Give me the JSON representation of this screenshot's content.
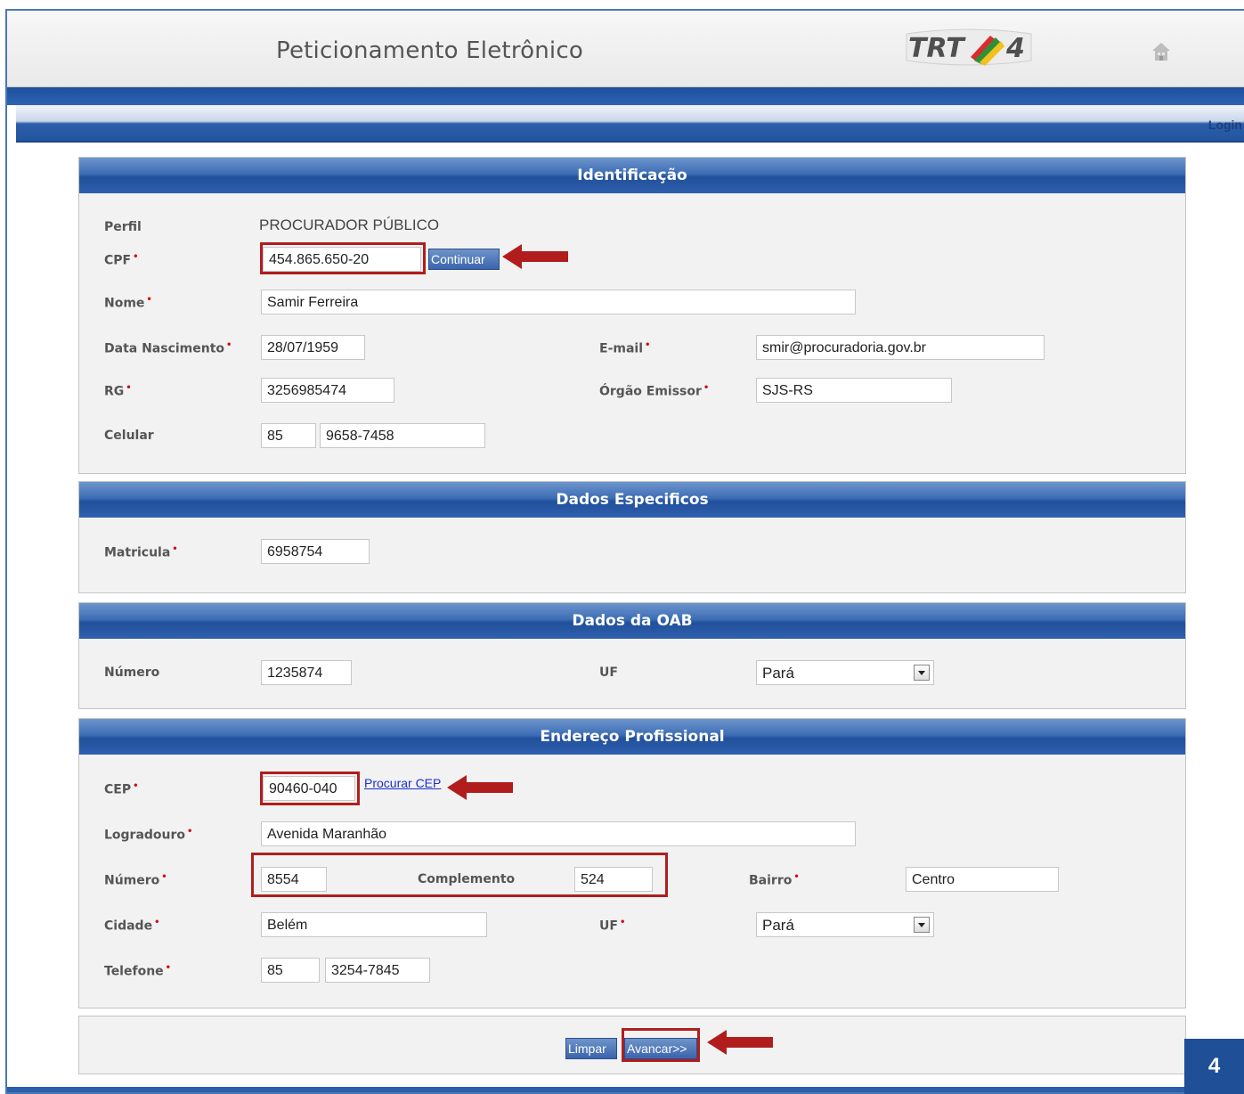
{
  "header": {
    "title": "Peticionamento Eletrônico",
    "logo_text": "TRT",
    "logo_number": "4"
  },
  "nav": {
    "login": "Login"
  },
  "identificacao": {
    "title": "Identificação",
    "perfil_label": "Perfil",
    "perfil_value": "PROCURADOR PÚBLICO",
    "cpf_label": "CPF",
    "cpf_value": "454.865.650-20",
    "continuar_button": "Continuar",
    "nome_label": "Nome",
    "nome_value": "Samir Ferreira",
    "data_nascimento_label": "Data Nascimento",
    "data_nascimento_value": "28/07/1959",
    "email_label": "E-mail",
    "email_value": "smir@procuradoria.gov.br",
    "rg_label": "RG",
    "rg_value": "3256985474",
    "orgao_emissor_label": "Órgão Emissor",
    "orgao_emissor_value": "SJS-RS",
    "celular_label": "Celular",
    "celular_ddd": "85",
    "celular_numero": "9658-7458"
  },
  "dados_especificos": {
    "title": "Dados Especificos",
    "matricula_label": "Matricula",
    "matricula_value": "6958754"
  },
  "dados_oab": {
    "title": "Dados da OAB",
    "numero_label": "Número",
    "numero_value": "1235874",
    "uf_label": "UF",
    "uf_value": "Pará"
  },
  "endereco": {
    "title": "Endereço Profissional",
    "cep_label": "CEP",
    "cep_value": "90460-040",
    "procurar_cep_link": "Procurar CEP",
    "logradouro_label": "Logradouro",
    "logradouro_value": "Avenida Maranhão",
    "numero_label": "Número",
    "numero_value": "8554",
    "complemento_label": "Complemento",
    "complemento_value": "524",
    "bairro_label": "Bairro",
    "bairro_value": "Centro",
    "cidade_label": "Cidade",
    "cidade_value": "Belém",
    "uf_label": "UF",
    "uf_value": "Pará",
    "telefone_label": "Telefone",
    "telefone_ddd": "85",
    "telefone_numero": "3254-7845"
  },
  "actions": {
    "limpar": "Limpar",
    "avancar": "Avancar>>"
  },
  "page_badge": "4",
  "colors": {
    "highlight": "#b11d1d",
    "header_blue": "#2d63b4",
    "required": "#d01010"
  }
}
